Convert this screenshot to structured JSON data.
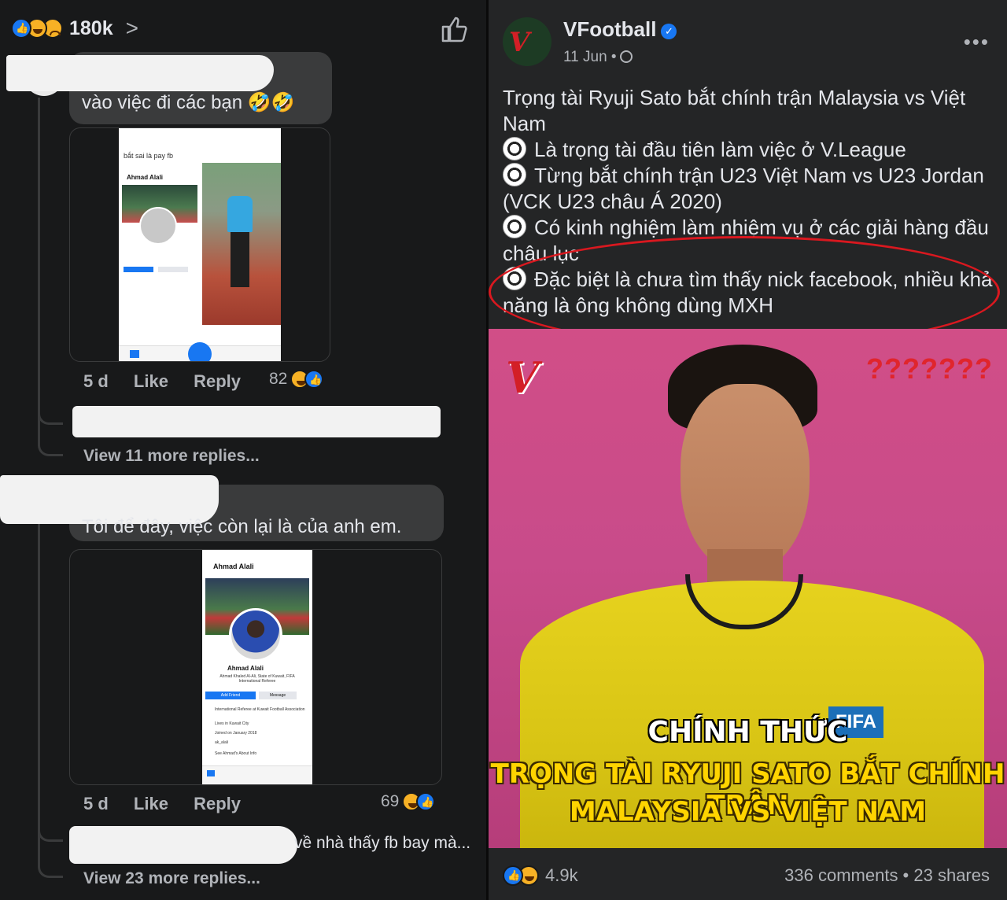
{
  "left": {
    "reaction_count": "180k",
    "comment1": {
      "text": "vào việc đi các bạn 🤣🤣",
      "image_caption": "bắt sai là pay fb",
      "profile_name": "Ahmad Alali",
      "time": "5 d",
      "like": "Like",
      "reply": "Reply",
      "reactions": "82",
      "view_more": "View 11 more replies..."
    },
    "comment2": {
      "text": "Tôi để đây, việc còn lại là của anh em.",
      "profile_name": "Ahmad Alali",
      "profile_sub": "Ahmad Khaled Al-Ali, State of Kuwait, FIFA International Referee",
      "add_friend": "Add Friend",
      "message": "Message",
      "info1": "International Referee at Kuwait Football Association",
      "info2": "Lives in Kuwait City",
      "info3": "Joined on January 2018",
      "info4": "ak_alali",
      "info5": "See Ahmad's About Info",
      "time": "5 d",
      "like": "Like",
      "reply": "Reply",
      "reactions": "69",
      "reply_preview": "về nhà thấy fb bay mà...",
      "view_more": "View 23 more replies..."
    }
  },
  "post": {
    "page_name": "VFootball",
    "date": "11 Jun •",
    "paragraphs": [
      "Trọng tài Ryuji Sato bắt chính trận Malaysia vs Việt Nam",
      "Là trọng tài đầu tiên làm việc ở V.League",
      "Từng bắt chính trận U23 Việt Nam vs U23 Jordan (VCK U23 châu Á 2020)",
      "Có kinh nghiệm làm nhiệm vụ ở các giải hàng đầu châu lục",
      "Đặc biệt là chưa tìm thấy nick facebook, nhiều khả năng là ông không dùng MXH"
    ],
    "image": {
      "question_marks": "???????",
      "caption1": "CHÍNH THỨC",
      "caption2": "TRỌNG TÀI RYUJI SATO BẮT CHÍNH TRẬN",
      "caption3": "MALAYSIA VS VIỆT NAM",
      "badge": "FIFA"
    },
    "reaction_count": "4.9k",
    "stats": "336 comments • 23 shares"
  }
}
